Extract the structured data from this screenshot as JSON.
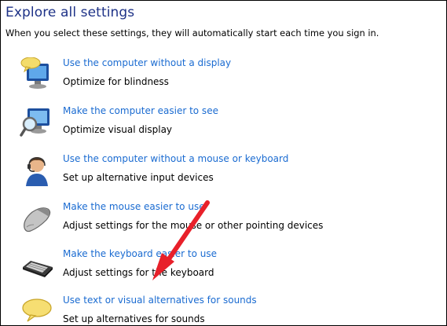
{
  "header": {
    "title": "Explore all settings",
    "subtitle": "When you select these settings, they will automatically start each time you sign in."
  },
  "settings": [
    {
      "link": "Use the computer without a display",
      "desc": "Optimize for blindness",
      "icon": "monitor-speech-icon"
    },
    {
      "link": "Make the computer easier to see",
      "desc": "Optimize visual display",
      "icon": "magnifier-monitor-icon"
    },
    {
      "link": "Use the computer without a mouse or keyboard",
      "desc": "Set up alternative input devices",
      "icon": "user-headset-icon"
    },
    {
      "link": "Make the mouse easier to use",
      "desc": "Adjust settings for the mouse or other pointing devices",
      "icon": "mouse-icon"
    },
    {
      "link": "Make the keyboard easier to use",
      "desc": "Adjust settings for the keyboard",
      "icon": "keyboard-icon"
    },
    {
      "link": "Use text or visual alternatives for sounds",
      "desc": "Set up alternatives for sounds",
      "icon": "speech-bubble-icon"
    }
  ],
  "annotation": {
    "color": "#e8202a"
  }
}
